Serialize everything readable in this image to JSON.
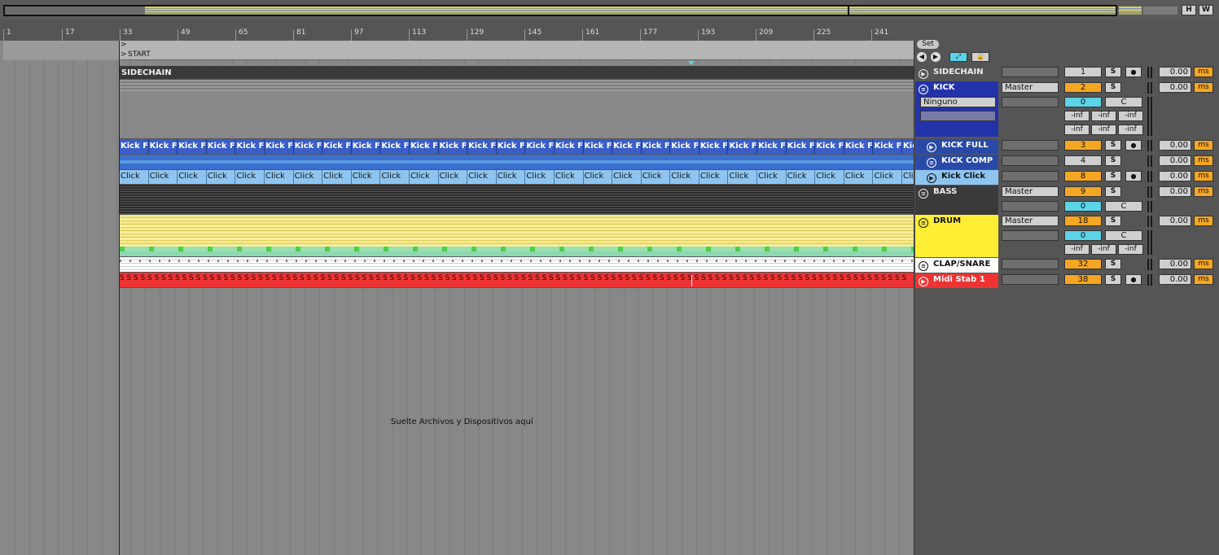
{
  "overview": {
    "h_label": "H",
    "w_label": "W"
  },
  "ruler": {
    "bars": [
      "1",
      "17",
      "33",
      "49",
      "65",
      "81",
      "97",
      "113",
      "129",
      "145",
      "161",
      "177",
      "193",
      "209",
      "225",
      "241"
    ]
  },
  "locators": {
    "start_label": "START",
    "arrow": ">"
  },
  "arrangement": {
    "drop_hint": "Suelte Archivos y Dispositivos aquí",
    "sidechain_lane_label": "SIDECHAIN",
    "kick_full_clip": "Kick Fu",
    "kick_full_clip_last": "Kick Ki",
    "click_clip": "Click",
    "click_clip_last": "Cli",
    "midi_note_glyph": "S"
  },
  "mixer": {
    "set_label": "Set",
    "left_arrow": "◀",
    "right_arrow": "▶",
    "expand_icon": "⤢",
    "lock_icon": "🔒",
    "solo_label": "S",
    "ms_label": "ms",
    "master_label": "Master",
    "none_label": "Ninguno",
    "center_label": "C",
    "inf_label": "-inf",
    "tracks": [
      {
        "name": "SIDECHAIN",
        "number": "1",
        "delay": "0.00",
        "color": "#555555"
      },
      {
        "name": "KICK",
        "number": "2",
        "delay": "0.00",
        "color": "#2233aa",
        "send": "0"
      },
      {
        "name": "KICK FULL",
        "number": "3",
        "delay": "0.00",
        "color": "#2a4aa8"
      },
      {
        "name": "KICK COMP",
        "number": "4",
        "delay": "0.00",
        "color": "#2a4aa8"
      },
      {
        "name": "Kick Click",
        "number": "8",
        "delay": "0.00",
        "color": "#8ec5f0"
      },
      {
        "name": "BASS",
        "number": "9",
        "delay": "0.00",
        "color": "#3a3a3a",
        "send": "0"
      },
      {
        "name": "DRUM",
        "number": "18",
        "delay": "0.00",
        "color": "#ffee33",
        "send": "0"
      },
      {
        "name": "CLAP/SNARE",
        "number": "32",
        "delay": "0.00",
        "color": "#ffffff"
      },
      {
        "name": "Midi Stab 1",
        "number": "38",
        "delay": "0.00",
        "color": "#ee3333"
      }
    ]
  }
}
